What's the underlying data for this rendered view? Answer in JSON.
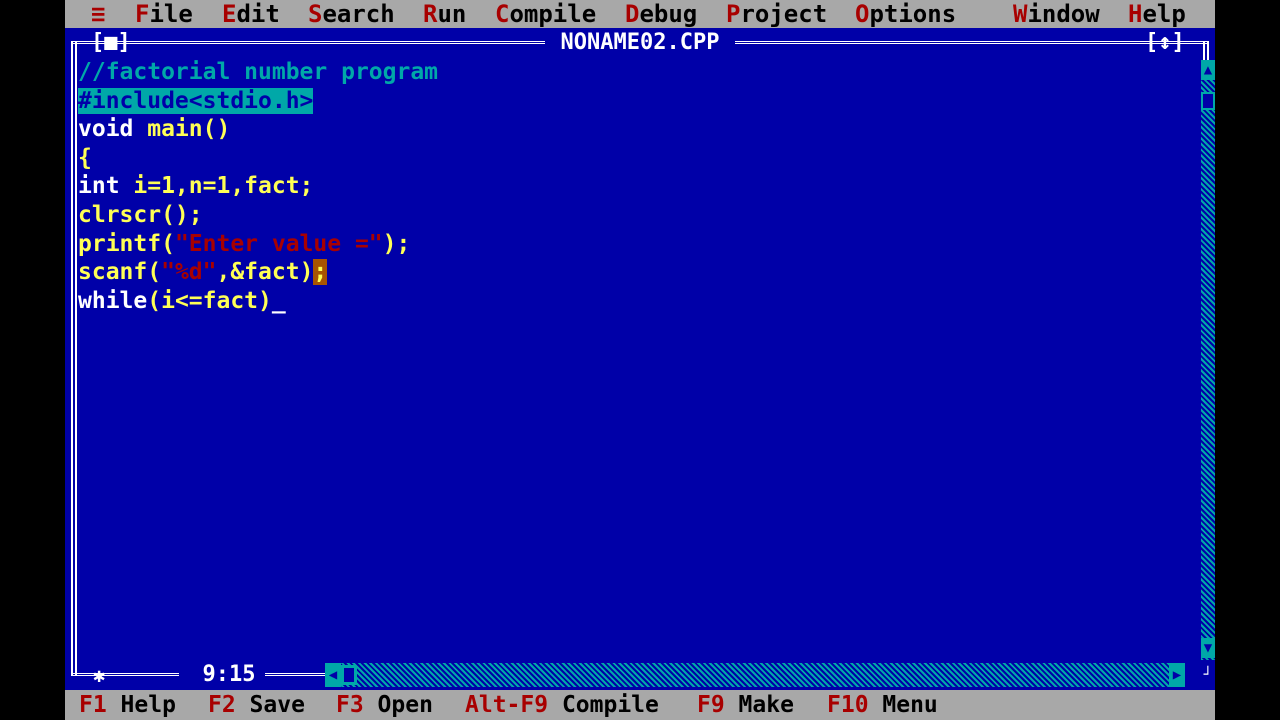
{
  "menubar": {
    "items": [
      {
        "label": "≡",
        "hot": ""
      },
      {
        "hot": "F",
        "rest": "ile"
      },
      {
        "hot": "E",
        "rest": "dit"
      },
      {
        "hot": "S",
        "rest": "earch"
      },
      {
        "hot": "R",
        "rest": "un"
      },
      {
        "hot": "C",
        "rest": "ompile"
      },
      {
        "hot": "D",
        "rest": "ebug"
      },
      {
        "hot": "P",
        "rest": "roject"
      },
      {
        "hot": "O",
        "rest": "ptions"
      },
      {
        "hot": "W",
        "rest": "indow"
      },
      {
        "hot": "H",
        "rest": "elp"
      }
    ]
  },
  "window": {
    "title": "NONAME02.CPP",
    "close_box": "[■]",
    "zoom_box": "[↕]",
    "cursor_position": "9:15"
  },
  "code": {
    "line1": "//factorial number program",
    "line2": "#include<stdio.h>",
    "line3_a": "void",
    "line3_b": " main()",
    "line4": "{",
    "line5_a": "int",
    "line5_b": " i=1,n=1,fact;",
    "line6": "clrscr();",
    "line7_a": "printf(",
    "line7_b": "\"Enter value =\"",
    "line7_c": ");",
    "line8_a": "scanf(",
    "line8_b": "\"%d\"",
    "line8_c": ",&fact)",
    "line8_d": ";",
    "line9_a": "while",
    "line9_b": "(i<=fact)",
    "line9_cursor": "_"
  },
  "statusbar": {
    "f1_key": "F1",
    "f1_label": " Help",
    "f2_key": "F2",
    "f2_label": " Save",
    "f3_key": "F3",
    "f3_label": " Open",
    "altf9_key": "Alt-F9",
    "altf9_label": " Compile",
    "f9_key": "F9",
    "f9_label": " Make",
    "f10_key": "F10",
    "f10_label": " Menu"
  },
  "colors": {
    "background": "#0000a8",
    "menubar": "#a8a8a8",
    "hotkey": "#a80000",
    "comment": "#00a8a8",
    "code_text": "#ffff55",
    "string": "#a80000"
  }
}
